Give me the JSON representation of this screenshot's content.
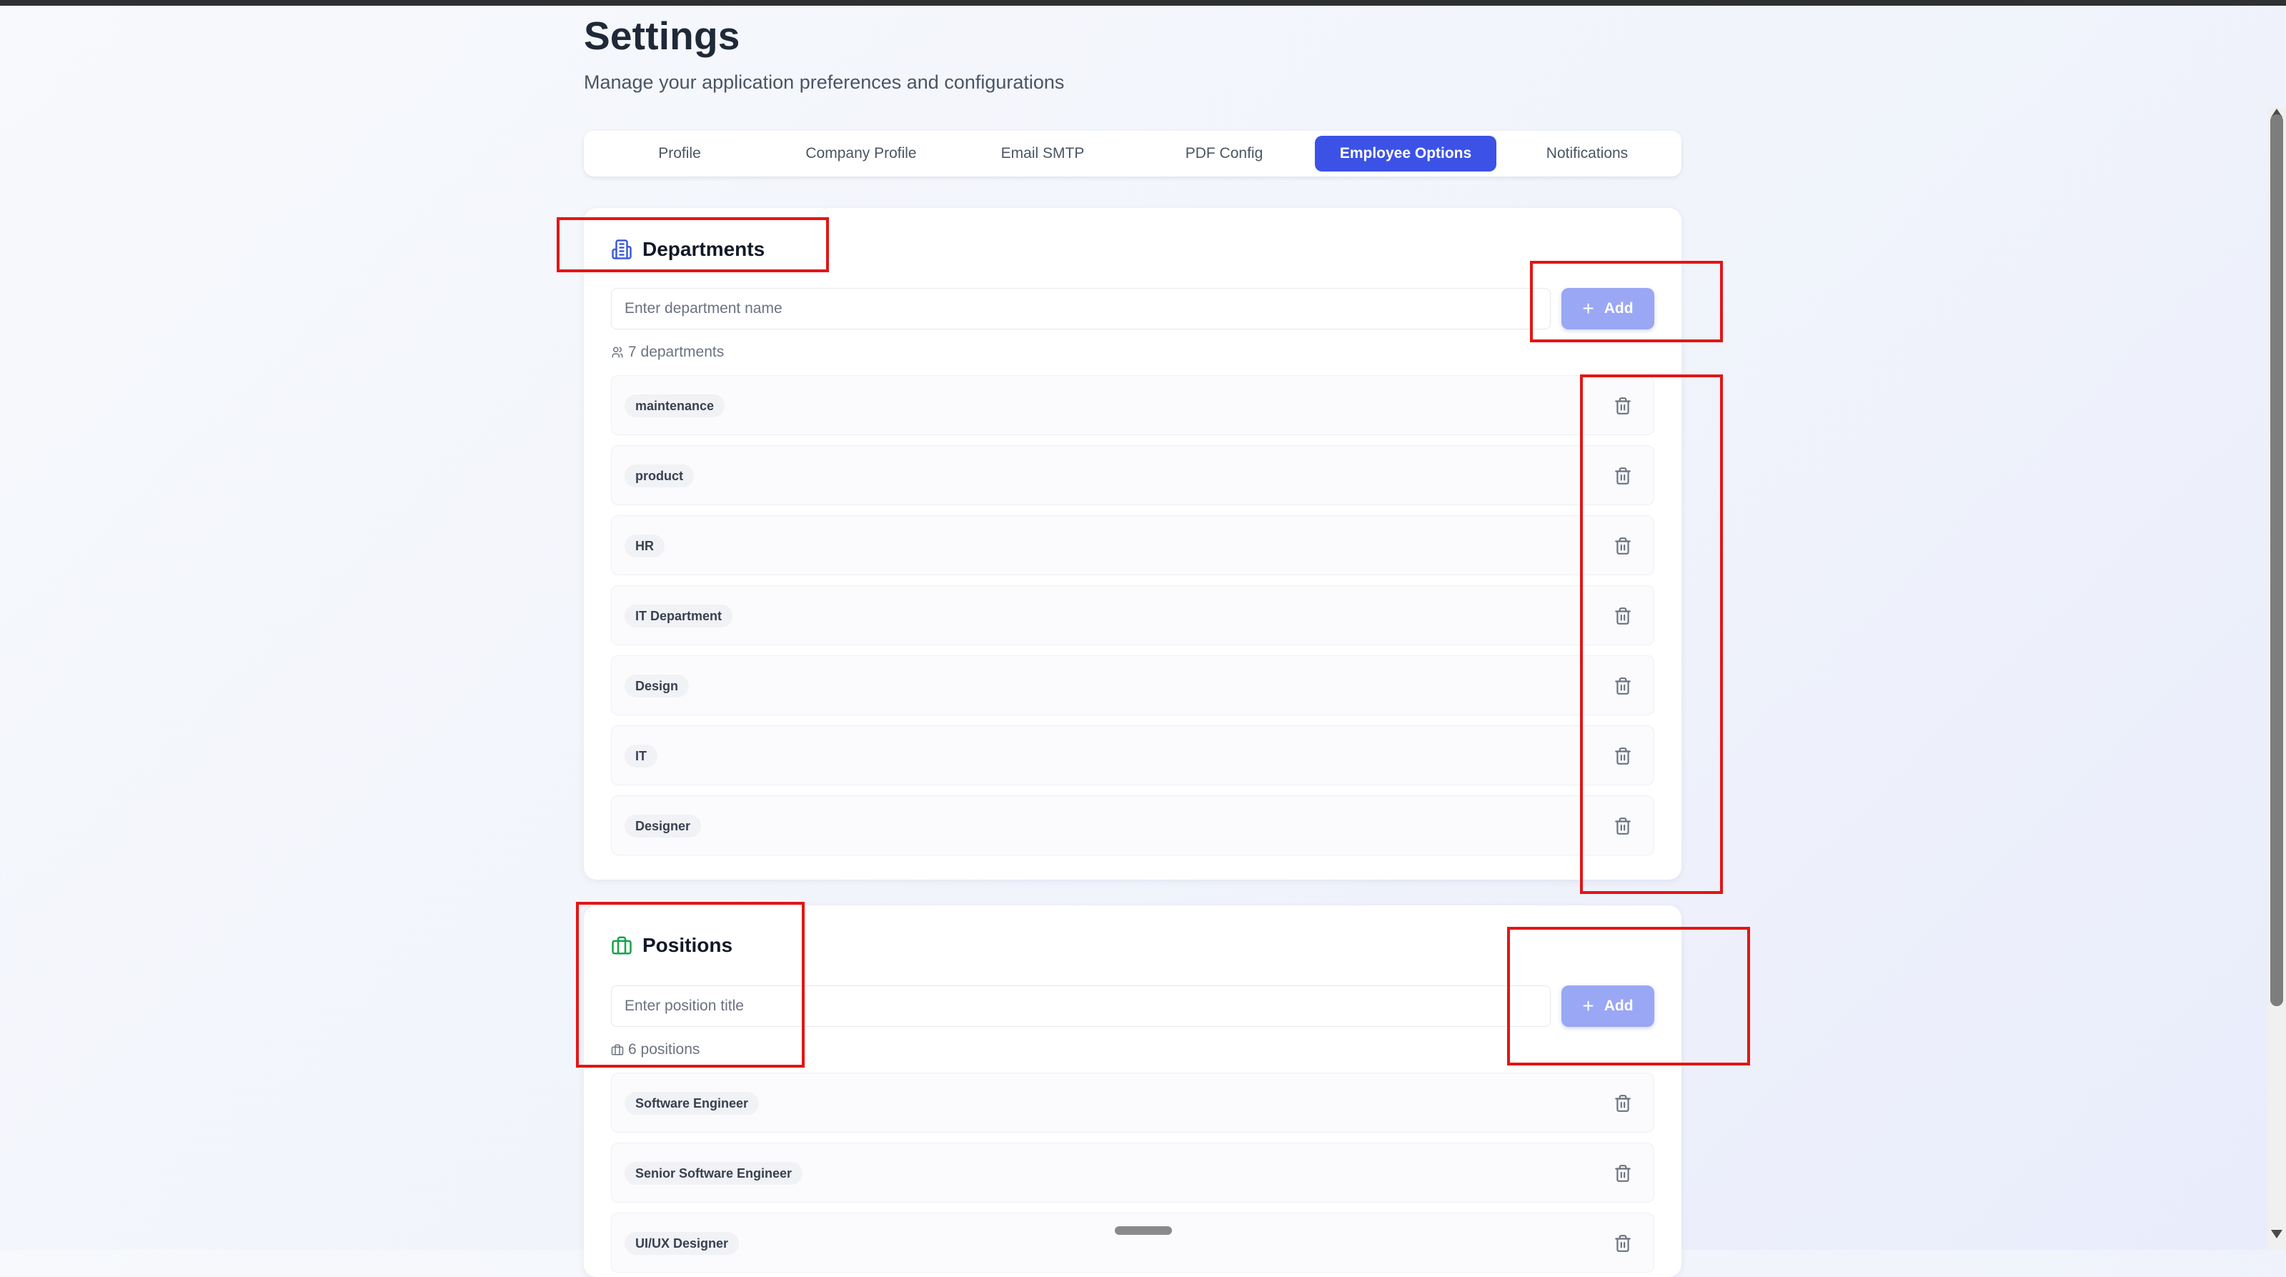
{
  "page": {
    "title": "Settings",
    "subtitle": "Manage your application preferences and configurations"
  },
  "tabs": [
    {
      "label": "Profile",
      "active": false
    },
    {
      "label": "Company Profile",
      "active": false
    },
    {
      "label": "Email SMTP",
      "active": false
    },
    {
      "label": "PDF Config",
      "active": false
    },
    {
      "label": "Employee Options",
      "active": true
    },
    {
      "label": "Notifications",
      "active": false
    }
  ],
  "departments": {
    "title": "Departments",
    "icon": "building-icon",
    "input_placeholder": "Enter department name",
    "input_value": "",
    "add_label": "Add",
    "count_text": "7 departments",
    "count_icon": "users-icon",
    "items": [
      "maintenance",
      "product",
      "HR",
      "IT Department",
      "Design",
      "IT",
      "Designer"
    ]
  },
  "positions": {
    "title": "Positions",
    "icon": "briefcase-icon",
    "input_placeholder": "Enter position title",
    "input_value": "",
    "add_label": "Add",
    "count_text": "6 positions",
    "count_icon": "briefcase-icon",
    "items": [
      "Software Engineer",
      "Senior Software Engineer",
      "UI/UX Designer"
    ]
  },
  "colors": {
    "accent": "#3c52e6",
    "add_button": "#9aa7f4",
    "annotation_red": "#e31515",
    "department_icon": "#3b5bdb",
    "position_icon": "#16a34a"
  }
}
